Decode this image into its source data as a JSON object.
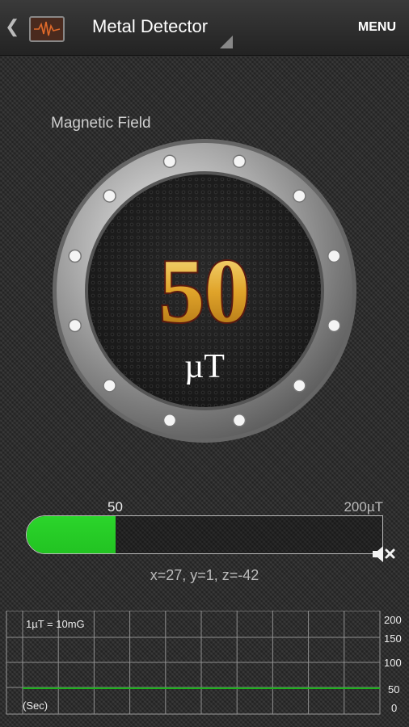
{
  "header": {
    "back": "❮",
    "title": "Metal Detector",
    "menu_label": "MENU",
    "icon": "waveform-icon"
  },
  "gauge": {
    "label": "Magnetic Field",
    "value": "50",
    "unit": "µT",
    "ring_color": "#c9c9c9",
    "value_color": "#d89a1c"
  },
  "meter": {
    "current_label": "50",
    "max_label": "200µT",
    "fraction": 0.25,
    "fill_color": "#22c322",
    "mute_icon": "speaker-muted-icon"
  },
  "axes_readout": "x=27,  y=1,  z=-42",
  "graph": {
    "note": "1µT = 10mG",
    "x_label": "(Sec)",
    "y_ticks": [
      "200",
      "150",
      "100",
      "50",
      "0"
    ],
    "line_color": "#1fae1f"
  }
}
